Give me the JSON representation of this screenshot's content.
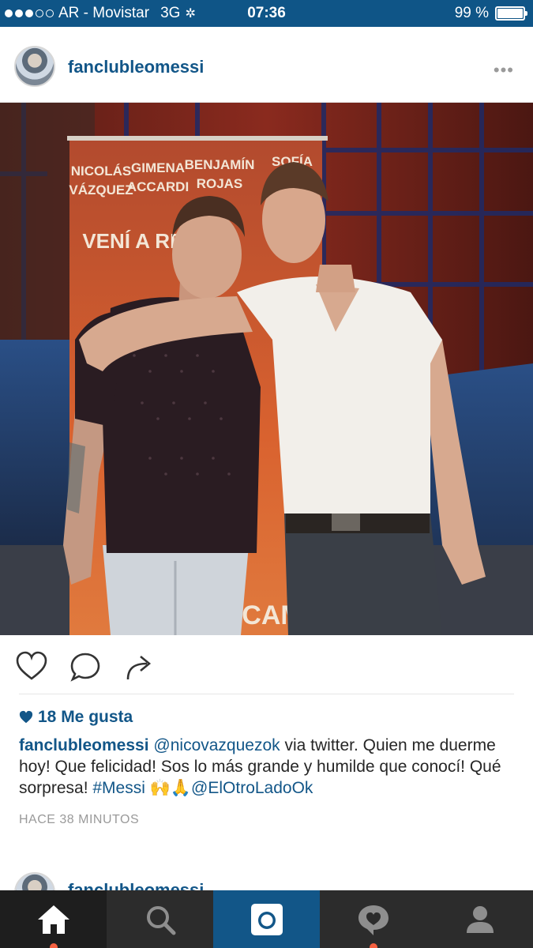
{
  "status_bar": {
    "carrier": "AR - Movistar",
    "network": "3G",
    "time": "07:36",
    "battery_text": "99 %",
    "battery_level": 0.99,
    "signal_bars_filled": 3,
    "signal_bars_total": 5
  },
  "post": {
    "username": "fanclubleomessi",
    "more_label": "•••",
    "likes": "18 Me gusta",
    "caption_user": "fanclubleomessi",
    "caption_parts": [
      {
        "text": "@nicovazquezok",
        "type": "link"
      },
      {
        "text": " via twitter. Quien me duerme hoy! Que felicidad! Sos lo más grande y humilde que conocí! Qué sorpresa! ",
        "type": "text"
      },
      {
        "text": "#Messi",
        "type": "link"
      },
      {
        "text": " 🙌🙏",
        "type": "text"
      },
      {
        "text": "@ElOtroLadoOk",
        "type": "link"
      }
    ],
    "time_ago": "HACE 38 MINUTOS",
    "photo_banner": {
      "names": [
        "NICOLÁS",
        "GIMENA",
        "BENJAMÍN",
        "SOFÍA"
      ],
      "surnames": [
        "VÁZQUEZ",
        "ACCARDI",
        "ROJAS",
        ""
      ],
      "tagline": "VENÍ A REÍ",
      "bottom_text": "CAM"
    }
  },
  "next_post": {
    "username": "fanclubleomessi"
  },
  "colors": {
    "brand_blue": "#125688",
    "status_bar": "#0f5587",
    "tab_bar": "#2c2c2c",
    "notification": "#f56040"
  },
  "tabs": [
    {
      "name": "home",
      "icon": "home-icon",
      "active": true,
      "has_notification": true
    },
    {
      "name": "search",
      "icon": "search-icon",
      "active": false,
      "has_notification": false
    },
    {
      "name": "camera",
      "icon": "camera-icon",
      "active": false,
      "has_notification": false
    },
    {
      "name": "activity",
      "icon": "heart-bubble-icon",
      "active": false,
      "has_notification": true
    },
    {
      "name": "profile",
      "icon": "profile-icon",
      "active": false,
      "has_notification": false
    }
  ]
}
